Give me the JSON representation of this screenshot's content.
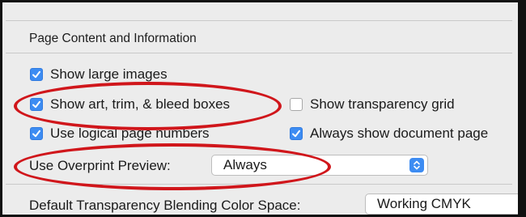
{
  "section": {
    "title": "Page Content and Information"
  },
  "options": {
    "show_large_images": {
      "label": "Show large images",
      "checked": true
    },
    "show_art_trim_bleed": {
      "label": "Show art, trim, & bleed boxes",
      "checked": true
    },
    "show_transparency_grid": {
      "label": "Show transparency grid",
      "checked": false
    },
    "use_logical_page_numbers": {
      "label": "Use logical page numbers",
      "checked": true
    },
    "always_show_document_page": {
      "label": "Always show document page",
      "checked": true
    }
  },
  "overprint": {
    "label": "Use Overprint Preview:",
    "value": "Always"
  },
  "blending": {
    "label": "Default Transparency Blending Color Space:",
    "value": "Working CMYK"
  },
  "colors": {
    "accent": "#3d8cf2",
    "annotation": "#d0161b",
    "panel_bg": "#ececec"
  }
}
